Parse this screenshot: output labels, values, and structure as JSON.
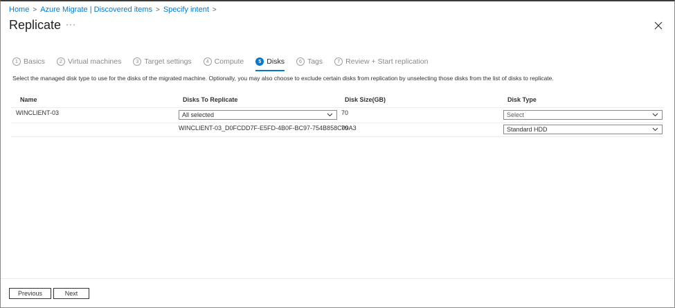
{
  "breadcrumb": [
    "Home",
    "Azure Migrate | Discovered items",
    "Specify intent"
  ],
  "page": {
    "title": "Replicate",
    "more": "···"
  },
  "tabs": [
    {
      "num": "1",
      "label": "Basics"
    },
    {
      "num": "2",
      "label": "Virtual machines"
    },
    {
      "num": "3",
      "label": "Target settings"
    },
    {
      "num": "4",
      "label": "Compute"
    },
    {
      "num": "5",
      "label": "Disks"
    },
    {
      "num": "6",
      "label": "Tags"
    },
    {
      "num": "7",
      "label": "Review + Start replication"
    }
  ],
  "active_tab": "Disks",
  "description": "Select the managed disk type to use for the disks of the migrated machine. Optionally, you may also choose to exclude certain disks from replication by unselecting those disks from the list of disks to replicate.",
  "table": {
    "headers": [
      "Name",
      "Disks To Replicate",
      "Disk Size(GB)",
      "Disk Type"
    ],
    "rows": [
      {
        "name": "WINCLIENT-03",
        "disks": "All selected",
        "size": "70",
        "type": "Select"
      },
      {
        "name": "",
        "disks": "WINCLIENT-03_D0FCDD7F-E5FD-4B0F-BC97-754B858C09A3",
        "size": "70",
        "type": "Standard HDD"
      }
    ]
  },
  "footer": {
    "previous": "Previous",
    "next": "Next"
  },
  "colors": {
    "accent": "#0078d4",
    "text": "#323130",
    "border": "#8a8886"
  }
}
